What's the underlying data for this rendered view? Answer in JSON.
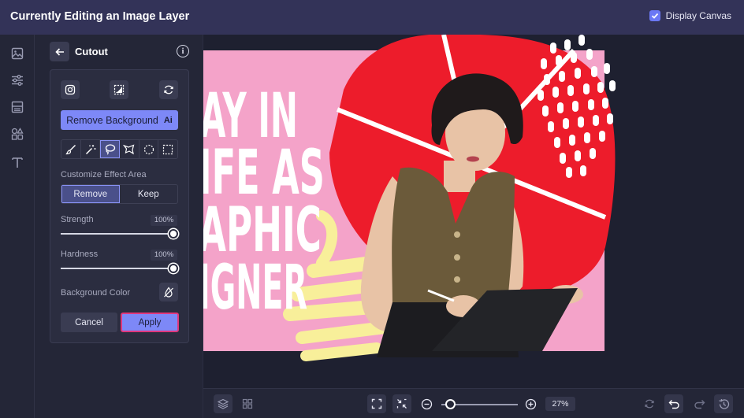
{
  "header": {
    "title": "Currently Editing an Image Layer",
    "display_canvas_label": "Display Canvas",
    "display_canvas_checked": true
  },
  "left_rail": {
    "items": [
      {
        "icon": "image-icon"
      },
      {
        "icon": "adjustments-icon"
      },
      {
        "icon": "layout-icon"
      },
      {
        "icon": "elements-icon"
      },
      {
        "icon": "text-icon"
      }
    ]
  },
  "panel": {
    "title": "Cutout",
    "icons": [
      "back-arrow-icon",
      "info-icon",
      "instagram-icon",
      "transparency-icon",
      "refresh-icon"
    ],
    "remove_background_label": "Remove Background",
    "ai_badge": "Ai",
    "tools": [
      "brush-icon",
      "magic-wand-icon",
      "lasso-icon",
      "polygon-lasso-icon",
      "ellipse-select-icon",
      "rect-select-icon"
    ],
    "active_tool": "lasso-icon",
    "effect_area_label": "Customize Effect Area",
    "effect_area_options": [
      "Remove",
      "Keep"
    ],
    "effect_area_selected": "Remove",
    "strength_label": "Strength",
    "strength_value": "100%",
    "strength_level": 1.0,
    "hardness_label": "Hardness",
    "hardness_value": "100%",
    "hardness_level": 1.0,
    "background_color_label": "Background Color",
    "background_color_icon": "no-color-icon",
    "cancel_label": "Cancel",
    "apply_label": "Apply"
  },
  "canvas": {
    "poster_lines": [
      "AY IN",
      "IFE AS",
      "APHIC",
      "IGNER"
    ],
    "colors": {
      "pink": "#f4a3c9",
      "red": "#ed1c2b",
      "yellow": "#f8ef9a",
      "white": "#ffffff",
      "hair": "#1f1a1b",
      "vest": "#6b5a3a",
      "skin": "#e8c3a6",
      "tablet": "#232428"
    }
  },
  "bottom_bar": {
    "zoom_value": "27%",
    "zoom_level": 0.27,
    "icons": [
      "layers-icon",
      "grid-icon",
      "fit-screen-icon",
      "shrink-icon",
      "zoom-out-icon",
      "zoom-in-icon",
      "rotate-icon",
      "undo-icon",
      "redo-icon",
      "history-icon"
    ]
  }
}
